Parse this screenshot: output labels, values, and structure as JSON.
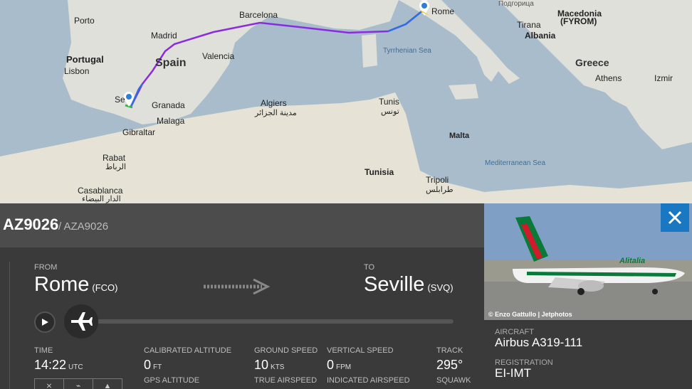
{
  "map": {
    "labels": {
      "porto": "Porto",
      "portugal": "Portugal",
      "lisbon": "Lisbon",
      "madrid": "Madrid",
      "spain": "Spain",
      "valencia": "Valencia",
      "barcelona": "Barcelona",
      "granada": "Granada",
      "malaga": "Malaga",
      "sevilla": "Se",
      "gibraltar": "Gibraltar",
      "rabat": "Rabat",
      "rabat_ar": "الرباط",
      "casablanca": "Casablanca",
      "casablanca_ar": "الدار البيضاء",
      "algiers": "Algiers",
      "algiers_ar": "مدينة الجزائر",
      "tunis": "Tunis",
      "tunis_ar": "تونس",
      "tunisia": "Tunisia",
      "tripoli": "Tripoli",
      "tripoli_ar": "طرابلس",
      "malta": "Malta",
      "rome": "Rome",
      "tirana": "Tirana",
      "albania": "Albania",
      "macedonia": "Macedonia",
      "fyrom": "(FYROM)",
      "greece": "Greece",
      "athens": "Athens",
      "izmir": "Izmir",
      "podgorica": "Подгорица",
      "tyrrhenian": "Tyrrhenian Sea",
      "mediterranean": "Mediterranean Sea"
    }
  },
  "flight": {
    "number": "AZ9026",
    "icao_number": "/ AZA9026",
    "from_label": "FROM",
    "from_city": "Rome",
    "from_code": "(FCO)",
    "to_label": "TO",
    "to_city": "Seville",
    "to_code": "(SVQ)",
    "progress_fraction": 0.0
  },
  "stats": {
    "time_label": "TIME",
    "time_value": "14:22",
    "time_unit": "UTC",
    "cal_alt_label": "CALIBRATED ALTITUDE",
    "cal_alt_value": "0",
    "cal_alt_unit": "FT",
    "gps_alt_label": "GPS ALTITUDE",
    "gs_label": "GROUND SPEED",
    "gs_value": "10",
    "gs_unit": "KTS",
    "tas_label": "TRUE AIRSPEED",
    "vs_label": "VERTICAL SPEED",
    "vs_value": "0",
    "vs_unit": "FPM",
    "ias_label": "INDICATED AIRSPEED",
    "track_label": "TRACK",
    "track_value": "295°",
    "squawk_label": "SQUAWK"
  },
  "aircraft": {
    "photo_credit": "© Enzo Gattullo | Jetphotos",
    "type_label": "AIRCRAFT",
    "type_value": "Airbus A319-111",
    "reg_label": "REGISTRATION",
    "reg_value": "EI-IMT",
    "livery_text": "Alitalia"
  },
  "colors": {
    "accent": "#1a78c2",
    "route_purple": "#8a2be2",
    "route_blue": "#2f6fe0"
  }
}
